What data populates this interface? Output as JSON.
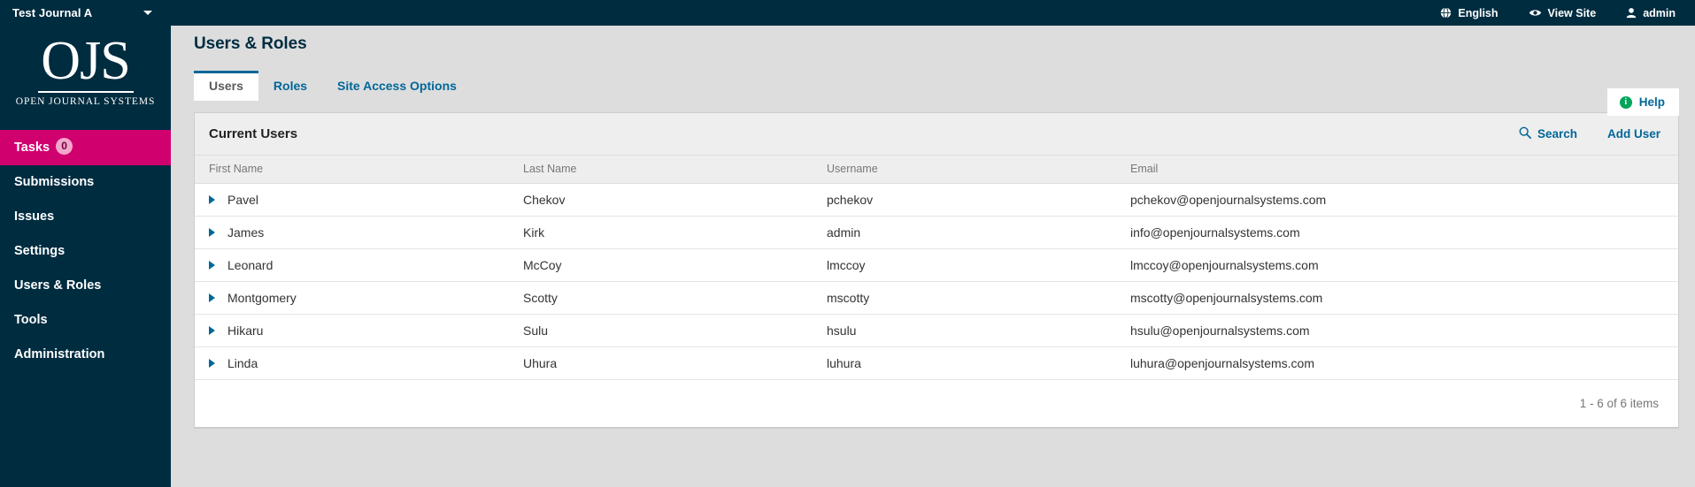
{
  "sidebar": {
    "journal_name": "Test Journal A",
    "logo": {
      "title": "OJS",
      "subtitle": "OPEN JOURNAL SYSTEMS"
    },
    "items": [
      {
        "label": "Tasks",
        "badge": "0",
        "active": true
      },
      {
        "label": "Submissions"
      },
      {
        "label": "Issues"
      },
      {
        "label": "Settings"
      },
      {
        "label": "Users & Roles"
      },
      {
        "label": "Tools"
      },
      {
        "label": "Administration"
      }
    ]
  },
  "topbar": {
    "language": "English",
    "view_site": "View Site",
    "user": "admin"
  },
  "header": {
    "page_title": "Users & Roles",
    "help_label": "Help"
  },
  "tabs": [
    {
      "label": "Users",
      "active": true
    },
    {
      "label": "Roles",
      "active": false
    },
    {
      "label": "Site Access Options",
      "active": false
    }
  ],
  "panel": {
    "title": "Current Users",
    "search_label": "Search",
    "add_user_label": "Add User",
    "columns": [
      "First Name",
      "Last Name",
      "Username",
      "Email"
    ],
    "rows": [
      {
        "first": "Pavel",
        "last": "Chekov",
        "username": "pchekov",
        "email": "pchekov@openjournalsystems.com"
      },
      {
        "first": "James",
        "last": "Kirk",
        "username": "admin",
        "email": "info@openjournalsystems.com"
      },
      {
        "first": "Leonard",
        "last": "McCoy",
        "username": "lmccoy",
        "email": "lmccoy@openjournalsystems.com"
      },
      {
        "first": "Montgomery",
        "last": "Scotty",
        "username": "mscotty",
        "email": "mscotty@openjournalsystems.com"
      },
      {
        "first": "Hikaru",
        "last": "Sulu",
        "username": "hsulu",
        "email": "hsulu@openjournalsystems.com"
      },
      {
        "first": "Linda",
        "last": "Uhura",
        "username": "luhura",
        "email": "luhura@openjournalsystems.com"
      }
    ],
    "pagination": "1 - 6 of 6 items"
  },
  "colors": {
    "navy": "#002c40",
    "pink": "#d0006f",
    "link_blue": "#006798",
    "green": "#00a65a",
    "page_bg": "#dddddd"
  }
}
